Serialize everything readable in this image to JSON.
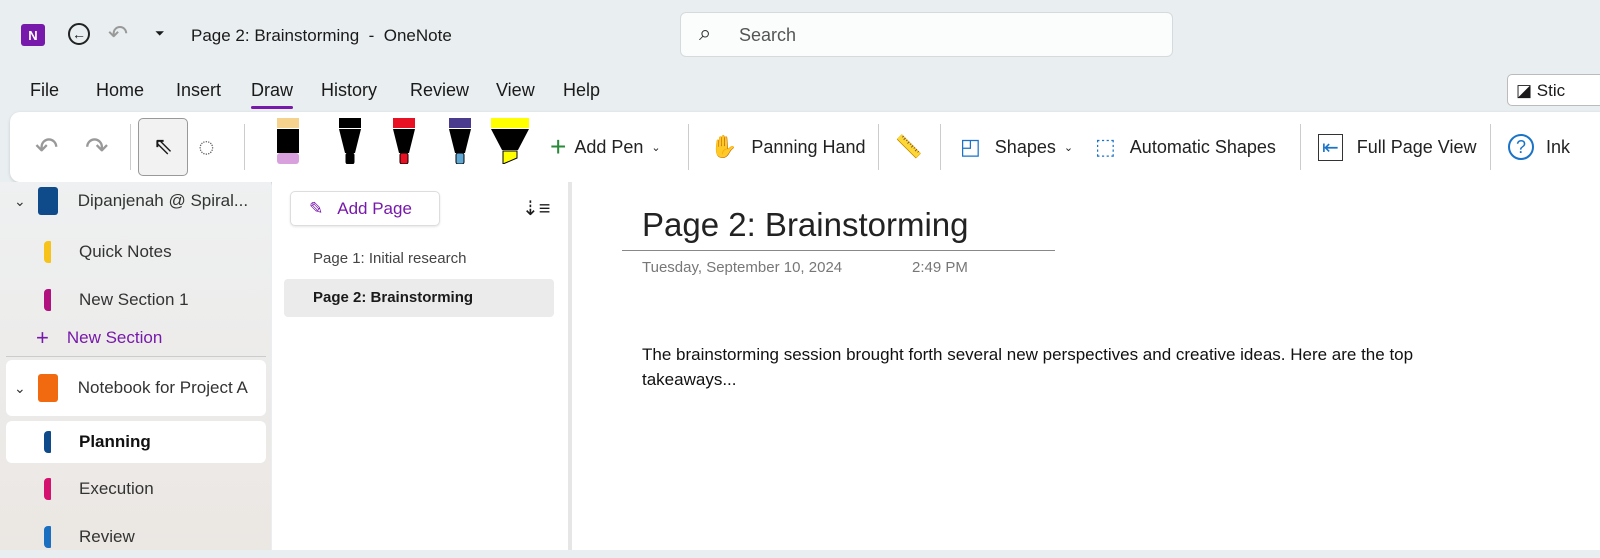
{
  "titlebar": {
    "title": "Page 2: Brainstorming  -  OneNote",
    "search_placeholder": "Search"
  },
  "menu": {
    "tabs": [
      "File",
      "Home",
      "Insert",
      "Draw",
      "History",
      "Review",
      "View",
      "Help"
    ],
    "active": "Draw",
    "sticky": "Stic"
  },
  "ribbon": {
    "add_pen": "Add Pen",
    "panning_hand": "Panning Hand",
    "shapes": "Shapes",
    "automatic_shapes": "Automatic Shapes",
    "full_page_view": "Full Page View",
    "ink_help": "Ink"
  },
  "pens": [
    {
      "cap": "#f5d28e",
      "tip": "#d9a0de",
      "type": "eraser"
    },
    {
      "cap": "#000000",
      "tip": "#000000",
      "type": "pen"
    },
    {
      "cap": "#e81123",
      "tip": "#e81123",
      "type": "pen"
    },
    {
      "cap": "#4a3b8f",
      "tip": "#5fa8d3",
      "type": "pen"
    },
    {
      "cap": "#ffff00",
      "tip": "#ffff00",
      "type": "highlighter"
    }
  ],
  "sidebar": {
    "notebook1": "Dipanjenah @ Spiral...",
    "sections1": [
      {
        "label": "Quick Notes",
        "color": "#f7c21a"
      },
      {
        "label": "New Section 1",
        "color": "#b0117f"
      }
    ],
    "new_section": "New Section",
    "notebook2": "Notebook for Project A",
    "sections2": [
      {
        "label": "Planning",
        "color": "#0f4a8a"
      },
      {
        "label": "Execution",
        "color": "#d4116e"
      },
      {
        "label": "Review",
        "color": "#1a6fc0"
      }
    ]
  },
  "pages": {
    "add_page": "Add Page",
    "items": [
      "Page 1: Initial research",
      "Page 2: Brainstorming"
    ]
  },
  "page": {
    "title": "Page 2: Brainstorming",
    "date": "Tuesday, September 10, 2024",
    "time": "2:49 PM",
    "body": "The brainstorming session brought forth several new perspectives and creative ideas. Here are the top takeaways..."
  }
}
